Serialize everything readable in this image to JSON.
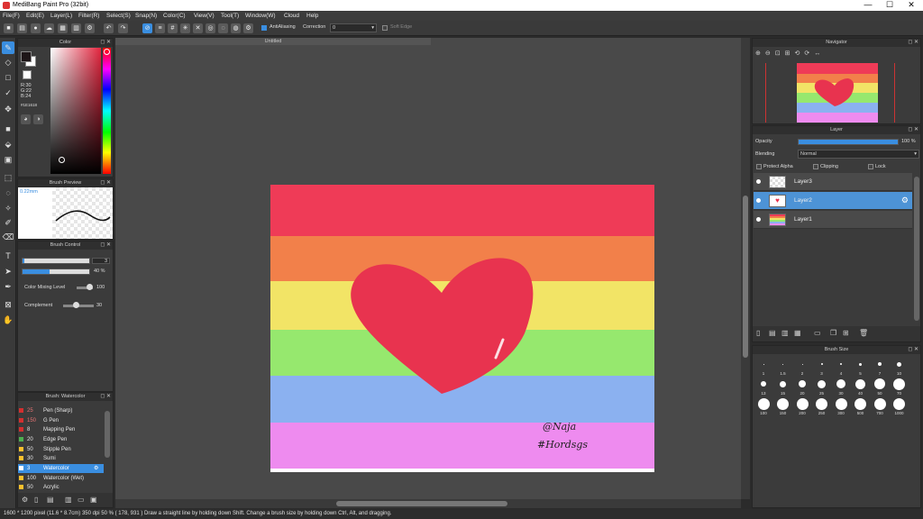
{
  "window": {
    "title": "MediBang Paint Pro (32bit)",
    "minimize": "—",
    "maximize": "☐",
    "close": "✕"
  },
  "menu": [
    "File(F)",
    "Edit(E)",
    "Layer(L)",
    "Filter(R)",
    "Select(S)",
    "Snap(N)",
    "Color(C)",
    "View(V)",
    "Tool(T)",
    "Window(W)",
    "Cloud",
    "Help"
  ],
  "toolbar": {
    "antialiasing": "AntiAliasing",
    "correction_label": "Correction",
    "correction_value": "0",
    "soft_edge": "Soft Edge"
  },
  "color_panel": {
    "title": "Color",
    "r": "R:30",
    "g": "G:22",
    "b": "B:24",
    "hex": "#1E1618"
  },
  "brush_preview": {
    "title": "Brush Preview",
    "size_text": "0.22mm"
  },
  "brush_control": {
    "title": "Brush Control",
    "size_value": "3",
    "opacity_value": "40 %",
    "opacity_fraction": 0.4,
    "color_mixing_label": "Color Mixing Level",
    "color_mixing_value": "100",
    "complement_label": "Complement",
    "complement_value": "30"
  },
  "brush_panel": {
    "title": "Brush: Watercolor",
    "items": [
      {
        "size": "25",
        "name": "Pen (Sharp)",
        "color": "#d32f2f"
      },
      {
        "size": "150",
        "name": "G Pen",
        "color": "#d32f2f"
      },
      {
        "size": "8",
        "name": "Mapping Pen",
        "color": "#d32f2f"
      },
      {
        "size": "20",
        "name": "Edge Pen",
        "color": "#4caf50"
      },
      {
        "size": "50",
        "name": "Stipple Pen",
        "color": "#fbc02d"
      },
      {
        "size": "30",
        "name": "Sumi",
        "color": "#fbc02d"
      },
      {
        "size": "3",
        "name": "Watercolor",
        "color": "#ffffff"
      },
      {
        "size": "100",
        "name": "Watercolor (Wet)",
        "color": "#fbc02d"
      },
      {
        "size": "50",
        "name": "Acrylic",
        "color": "#fbc02d"
      }
    ]
  },
  "document": {
    "tab_title": "Untitled",
    "signature_line1": "@Naja",
    "signature_line2": "#Hordsgs"
  },
  "navigator": {
    "title": "Navigator"
  },
  "layer_panel": {
    "title": "Layer",
    "opacity_label": "Opacity",
    "opacity_value": "100 %",
    "blending_label": "Blending",
    "blending_value": "Normal",
    "protect_alpha": "Protect Alpha",
    "clipping": "Clipping",
    "lock": "Lock",
    "layers": [
      {
        "name": "Layer3"
      },
      {
        "name": "Layer2"
      },
      {
        "name": "Layer1"
      }
    ]
  },
  "brush_size_panel": {
    "title": "Brush Size",
    "row1": [
      "1",
      "1.5",
      "2",
      "3",
      "4",
      "5",
      "7",
      "10"
    ],
    "row2": [
      "13",
      "15",
      "20",
      "25",
      "30",
      "40",
      "50",
      "70"
    ],
    "row3": [
      "100",
      "150",
      "200",
      "250",
      "300",
      "500",
      "700",
      "1000"
    ]
  },
  "status": {
    "text": "1600 * 1200 pixel  (11.6 * 8.7cm)  350 dpi  50 %  ( 178, 931 )  Draw a straight line by holding down Shift. Change a brush size by holding down Ctrl, Alt, and dragging."
  },
  "colors": {
    "accent": "#3a8ee0",
    "primary_color": "#1e1618",
    "stripe_red": "#ef3b57",
    "stripe_orange": "#f2804a",
    "stripe_yellow": "#f2e466",
    "stripe_green": "#96e86e",
    "stripe_blue": "#8bb1f0",
    "stripe_purple": "#ee8bef",
    "heart": "#e8334f"
  }
}
